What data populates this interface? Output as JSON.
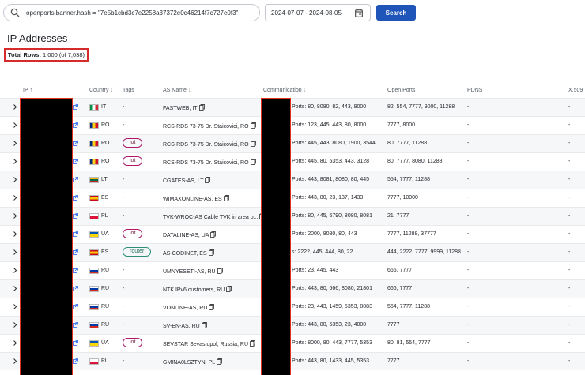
{
  "search": {
    "value": "openports.banner.hash = \"7e5b1cbd3c7e2258a37372e0c46214f7c727e0f3\""
  },
  "date_range": {
    "value": "2024-07-07 - 2024-08-05"
  },
  "search_button": "Search",
  "page_title": "IP Addresses",
  "total_rows": {
    "label": "Total Rows:",
    "value": "1,000 (of 7,038)"
  },
  "columns": [
    "IP",
    "Country",
    "Tags",
    "AS Name",
    "Communication",
    "Open Ports",
    "PDNS",
    "X.509"
  ],
  "colors": {
    "primary": "#1f54b8",
    "highlight": "#d62b2b",
    "tag_iot": "#b0176a",
    "tag_router": "#2e8f7a"
  },
  "rows": [
    {
      "flag": "IT",
      "country": "IT",
      "tag": "-",
      "as_name": "FASTWEB, IT",
      "comm": "Ports: 80, 8080, 82, 443, 9000",
      "open_ports": "82, 554, 7777, 9000, 11288",
      "pdns": "-",
      "x509": "-"
    },
    {
      "flag": "RO",
      "country": "RO",
      "tag": "-",
      "as_name": "RCS-RDS 73-75 Dr. Staicovici, RO",
      "comm": "Ports: 123, 445, 443, 80, 8000",
      "open_ports": "7777, 8000",
      "pdns": "-",
      "x509": "-"
    },
    {
      "flag": "RO",
      "country": "RO",
      "tag": "iot",
      "as_name": "RCS-RDS 73-75 Dr. Staicovici, RO",
      "comm": "Ports: 445, 443, 8080, 1900, 3544",
      "open_ports": "80, 7777, 11288",
      "pdns": "-",
      "x509": "-"
    },
    {
      "flag": "RO",
      "country": "RO",
      "tag": "iot",
      "as_name": "RCS-RDS 73-75 Dr. Staicovici, RO",
      "comm": "Ports: 445, 80, 5353, 443, 3128",
      "open_ports": "80, 7777, 8080, 11288",
      "pdns": "-",
      "x509": "-"
    },
    {
      "flag": "LT",
      "country": "LT",
      "tag": "-",
      "as_name": "CGATES-AS, LT",
      "comm": "Ports: 443, 8081, 8080, 80, 445",
      "open_ports": "554, 7777, 11288",
      "pdns": "-",
      "x509": "-"
    },
    {
      "flag": "ES",
      "country": "ES",
      "tag": "-",
      "as_name": "WIMAXONLINE-AS, ES",
      "comm": "Ports: 443, 80, 23, 137, 1433",
      "open_ports": "7777, 10000",
      "pdns": "-",
      "x509": "-"
    },
    {
      "flag": "PL",
      "country": "PL",
      "tag": "-",
      "as_name": "TVK-WROC-AS Cable TVK in area o...",
      "comm": "Ports: 80, 445, 6790, 8080, 8081",
      "open_ports": "21, 7777",
      "pdns": "-",
      "x509": "-"
    },
    {
      "flag": "UA",
      "country": "UA",
      "tag": "iot",
      "as_name": "DATALINE-AS, UA",
      "comm": "Ports: 2000, 8080, 80, 443",
      "open_ports": "7777, 11288, 37777",
      "pdns": "-",
      "x509": "-"
    },
    {
      "flag": "ES",
      "country": "ES",
      "tag": "router",
      "as_name": "AS-CODINET, ES",
      "comm": "s: 2222, 445, 444, 80, 22",
      "open_ports": "444, 2222, 7777, 9999, 11288",
      "pdns": "-",
      "x509": "-"
    },
    {
      "flag": "RU",
      "country": "RU",
      "tag": "-",
      "as_name": "UMNYESETI-AS, RU",
      "comm": "Ports: 23, 445, 443",
      "open_ports": "666, 7777",
      "pdns": "-",
      "x509": "-"
    },
    {
      "flag": "RU",
      "country": "RU",
      "tag": "-",
      "as_name": "NTK IPv6 customers, RU",
      "comm": "Ports: 443, 80, 666, 8080, 21801",
      "open_ports": "666, 7777",
      "pdns": "-",
      "x509": "-"
    },
    {
      "flag": "RU",
      "country": "RU",
      "tag": "-",
      "as_name": "VONLINE-AS, RU",
      "comm": "Ports: 23, 443, 1459, 5353, 8083",
      "open_ports": "554, 7777, 11288",
      "pdns": "-",
      "x509": "-"
    },
    {
      "flag": "RU",
      "country": "RU",
      "tag": "-",
      "as_name": "SV-EN-AS, RU",
      "comm": "Ports: 443, 80, 5353, 23, 4000",
      "open_ports": "7777",
      "pdns": "-",
      "x509": "-"
    },
    {
      "flag": "UA",
      "country": "UA",
      "tag": "iot",
      "as_name": "SEVSTAR Sevastopol, Russia, RU",
      "comm": "Ports: 8000, 80, 443, 7777, 5353",
      "open_ports": "80, 81, 554, 7777",
      "pdns": "-",
      "x509": "-"
    },
    {
      "flag": "PL",
      "country": "PL",
      "tag": "-",
      "as_name": "GMINA0LSZTYN, PL",
      "comm": "Ports: 443, 80, 1433, 445, 5353",
      "open_ports": "7777",
      "pdns": "-",
      "x509": "-"
    }
  ]
}
